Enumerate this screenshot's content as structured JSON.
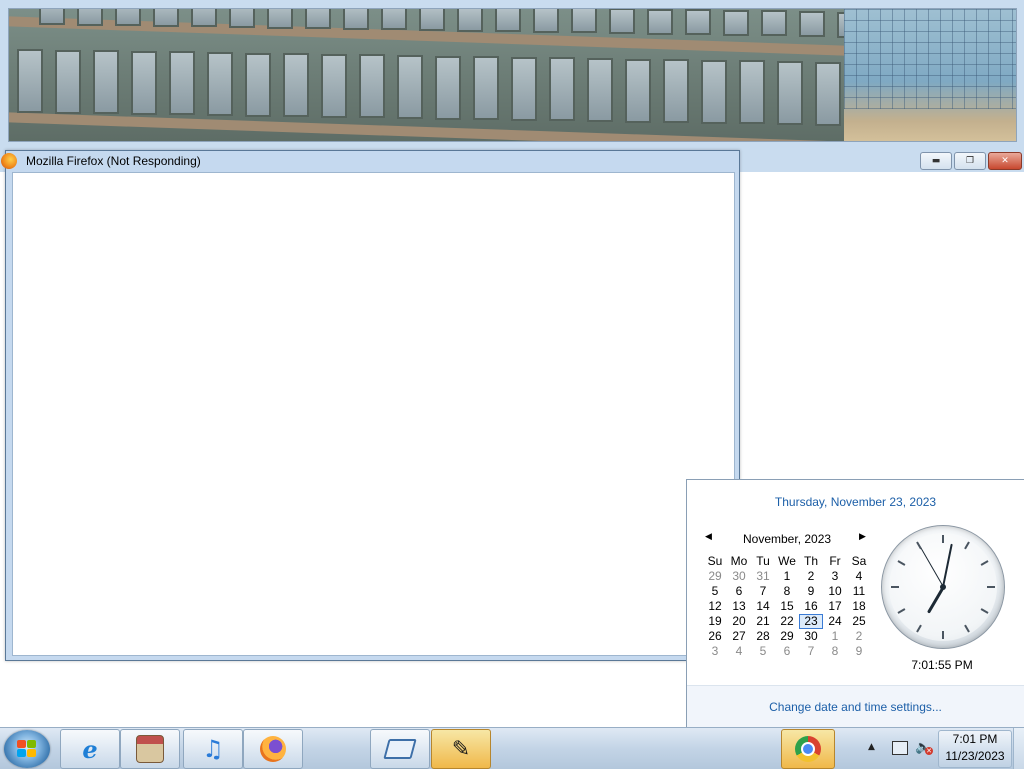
{
  "firefox_window": {
    "title": "Mozilla Firefox (Not Responding)"
  },
  "background_window": {
    "controls": {
      "minimize_icon": "minimize-icon",
      "restore_icon": "restore-icon",
      "close_icon": "close-icon"
    }
  },
  "flyout": {
    "long_date": "Thursday, November 23, 2023",
    "month_label": "November, 2023",
    "weekday_headers": [
      "Su",
      "Mo",
      "Tu",
      "We",
      "Th",
      "Fr",
      "Sa"
    ],
    "weeks": [
      [
        {
          "d": "29",
          "other": true
        },
        {
          "d": "30",
          "other": true
        },
        {
          "d": "31",
          "other": true
        },
        {
          "d": "1"
        },
        {
          "d": "2"
        },
        {
          "d": "3"
        },
        {
          "d": "4"
        }
      ],
      [
        {
          "d": "5"
        },
        {
          "d": "6"
        },
        {
          "d": "7"
        },
        {
          "d": "8"
        },
        {
          "d": "9"
        },
        {
          "d": "10"
        },
        {
          "d": "11"
        }
      ],
      [
        {
          "d": "12"
        },
        {
          "d": "13"
        },
        {
          "d": "14"
        },
        {
          "d": "15"
        },
        {
          "d": "16"
        },
        {
          "d": "17"
        },
        {
          "d": "18"
        }
      ],
      [
        {
          "d": "19"
        },
        {
          "d": "20"
        },
        {
          "d": "21"
        },
        {
          "d": "22"
        },
        {
          "d": "23",
          "today": true
        },
        {
          "d": "24"
        },
        {
          "d": "25"
        }
      ],
      [
        {
          "d": "26"
        },
        {
          "d": "27"
        },
        {
          "d": "28"
        },
        {
          "d": "29"
        },
        {
          "d": "30"
        },
        {
          "d": "1",
          "other": true
        },
        {
          "d": "2",
          "other": true
        }
      ],
      [
        {
          "d": "3",
          "other": true
        },
        {
          "d": "4",
          "other": true
        },
        {
          "d": "5",
          "other": true
        },
        {
          "d": "6",
          "other": true
        },
        {
          "d": "7",
          "other": true
        },
        {
          "d": "8",
          "other": true
        },
        {
          "d": "9",
          "other": true
        }
      ]
    ],
    "clock_time": "7:01:55 PM",
    "clock_hands": {
      "hour": 7,
      "minute": 1,
      "second": 55
    },
    "settings_link": "Change date and time settings..."
  },
  "taskbar": {
    "start_icon": "windows-orb-icon",
    "pinned": [
      {
        "name": "internet-explorer-icon",
        "color": "#1f7fd6"
      },
      {
        "name": "archive-app-icon",
        "color": "#b33a3a"
      },
      {
        "name": "itunes-icon",
        "color": "#2a7bd8"
      },
      {
        "name": "firefox-icon",
        "color": "#e8741d"
      },
      {
        "name": "tablet-app-icon",
        "color": "#3d6fa8"
      },
      {
        "name": "paint-app-icon",
        "color": "#2a2a2a"
      },
      {
        "name": "chrome-icon",
        "color": "#d9422f"
      }
    ],
    "tray_time": "7:01 PM",
    "tray_date": "11/23/2023"
  }
}
